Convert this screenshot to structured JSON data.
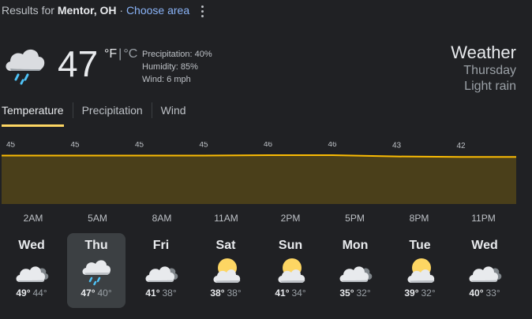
{
  "header": {
    "results_prefix": "Results for",
    "location": "Mentor, OH",
    "separator": "·",
    "choose_area": "Choose area"
  },
  "current": {
    "icon": "rain-cloud-icon",
    "temperature": "47",
    "unit_f": "°F",
    "unit_sep": "|",
    "unit_c": "°C",
    "precipitation": "Precipitation: 40%",
    "humidity": "Humidity: 85%",
    "wind": "Wind: 6 mph",
    "title": "Weather",
    "day": "Thursday",
    "condition": "Light rain"
  },
  "tabs": [
    {
      "label": "Temperature",
      "active": true
    },
    {
      "label": "Precipitation",
      "active": false
    },
    {
      "label": "Wind",
      "active": false
    }
  ],
  "chart_data": {
    "type": "area",
    "unit": "°F",
    "x": [
      "2AM",
      "5AM",
      "8AM",
      "11AM",
      "2PM",
      "5PM",
      "8PM",
      "11PM"
    ],
    "values": [
      45,
      45,
      45,
      45,
      46,
      46,
      43,
      42
    ],
    "labels": [
      "45",
      "45",
      "45",
      "45",
      "46",
      "46",
      "43",
      "42"
    ],
    "line_color": "#fbbc04",
    "fill_color": "#4a3f1a"
  },
  "days": [
    {
      "name": "Wed",
      "icon": "partly-cloudy-icon",
      "hi": "49°",
      "lo": "44°",
      "selected": false
    },
    {
      "name": "Thu",
      "icon": "rain-cloud-icon",
      "hi": "47°",
      "lo": "40°",
      "selected": true
    },
    {
      "name": "Fri",
      "icon": "partly-cloudy-icon",
      "hi": "41°",
      "lo": "38°",
      "selected": false
    },
    {
      "name": "Sat",
      "icon": "sun-behind-cloud-icon",
      "hi": "38°",
      "lo": "38°",
      "selected": false
    },
    {
      "name": "Sun",
      "icon": "sun-behind-cloud-icon",
      "hi": "41°",
      "lo": "34°",
      "selected": false
    },
    {
      "name": "Mon",
      "icon": "partly-cloudy-icon",
      "hi": "35°",
      "lo": "32°",
      "selected": false
    },
    {
      "name": "Tue",
      "icon": "sun-behind-cloud-icon",
      "hi": "39°",
      "lo": "32°",
      "selected": false
    },
    {
      "name": "Wed",
      "icon": "partly-cloudy-icon",
      "hi": "40°",
      "lo": "33°",
      "selected": false
    }
  ]
}
